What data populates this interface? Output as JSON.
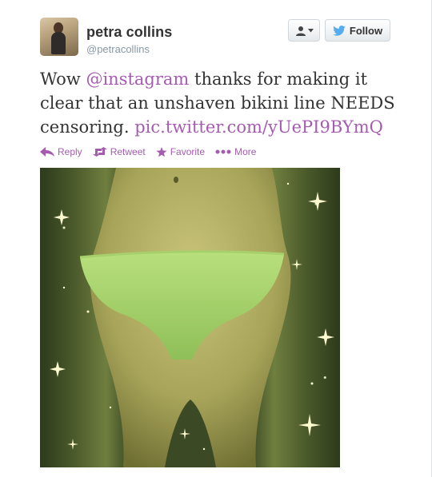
{
  "user": {
    "name": "petra collins",
    "handle": "@petracollins"
  },
  "header": {
    "follow_label": "Follow",
    "user_actions_icon": "person-icon",
    "follow_icon": "twitter-bird-icon"
  },
  "tweet": {
    "text_before": "Wow ",
    "mention": "@instagram",
    "text_middle": " thanks for making it clear that an unshaven bikini line NEEDS censoring. ",
    "link": "pic.twitter.com/yUePI9BYmQ"
  },
  "actions": {
    "reply_label": "Reply",
    "retweet_label": "Retweet",
    "favorite_label": "Favorite",
    "more_label": "More"
  },
  "colors": {
    "link": "#a55bb0",
    "brand_blue": "#55acee",
    "handle_gray": "#8899a6"
  }
}
